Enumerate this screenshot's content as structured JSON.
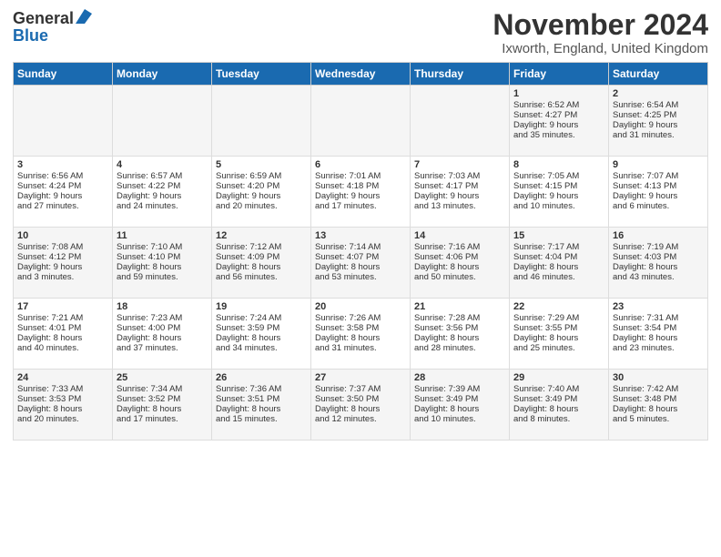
{
  "header": {
    "logo_line1": "General",
    "logo_line2": "Blue",
    "month_title": "November 2024",
    "location": "Ixworth, England, United Kingdom"
  },
  "days_of_week": [
    "Sunday",
    "Monday",
    "Tuesday",
    "Wednesday",
    "Thursday",
    "Friday",
    "Saturday"
  ],
  "weeks": [
    [
      {
        "day": "",
        "info": ""
      },
      {
        "day": "",
        "info": ""
      },
      {
        "day": "",
        "info": ""
      },
      {
        "day": "",
        "info": ""
      },
      {
        "day": "",
        "info": ""
      },
      {
        "day": "1",
        "info": "Sunrise: 6:52 AM\nSunset: 4:27 PM\nDaylight: 9 hours\nand 35 minutes."
      },
      {
        "day": "2",
        "info": "Sunrise: 6:54 AM\nSunset: 4:25 PM\nDaylight: 9 hours\nand 31 minutes."
      }
    ],
    [
      {
        "day": "3",
        "info": "Sunrise: 6:56 AM\nSunset: 4:24 PM\nDaylight: 9 hours\nand 27 minutes."
      },
      {
        "day": "4",
        "info": "Sunrise: 6:57 AM\nSunset: 4:22 PM\nDaylight: 9 hours\nand 24 minutes."
      },
      {
        "day": "5",
        "info": "Sunrise: 6:59 AM\nSunset: 4:20 PM\nDaylight: 9 hours\nand 20 minutes."
      },
      {
        "day": "6",
        "info": "Sunrise: 7:01 AM\nSunset: 4:18 PM\nDaylight: 9 hours\nand 17 minutes."
      },
      {
        "day": "7",
        "info": "Sunrise: 7:03 AM\nSunset: 4:17 PM\nDaylight: 9 hours\nand 13 minutes."
      },
      {
        "day": "8",
        "info": "Sunrise: 7:05 AM\nSunset: 4:15 PM\nDaylight: 9 hours\nand 10 minutes."
      },
      {
        "day": "9",
        "info": "Sunrise: 7:07 AM\nSunset: 4:13 PM\nDaylight: 9 hours\nand 6 minutes."
      }
    ],
    [
      {
        "day": "10",
        "info": "Sunrise: 7:08 AM\nSunset: 4:12 PM\nDaylight: 9 hours\nand 3 minutes."
      },
      {
        "day": "11",
        "info": "Sunrise: 7:10 AM\nSunset: 4:10 PM\nDaylight: 8 hours\nand 59 minutes."
      },
      {
        "day": "12",
        "info": "Sunrise: 7:12 AM\nSunset: 4:09 PM\nDaylight: 8 hours\nand 56 minutes."
      },
      {
        "day": "13",
        "info": "Sunrise: 7:14 AM\nSunset: 4:07 PM\nDaylight: 8 hours\nand 53 minutes."
      },
      {
        "day": "14",
        "info": "Sunrise: 7:16 AM\nSunset: 4:06 PM\nDaylight: 8 hours\nand 50 minutes."
      },
      {
        "day": "15",
        "info": "Sunrise: 7:17 AM\nSunset: 4:04 PM\nDaylight: 8 hours\nand 46 minutes."
      },
      {
        "day": "16",
        "info": "Sunrise: 7:19 AM\nSunset: 4:03 PM\nDaylight: 8 hours\nand 43 minutes."
      }
    ],
    [
      {
        "day": "17",
        "info": "Sunrise: 7:21 AM\nSunset: 4:01 PM\nDaylight: 8 hours\nand 40 minutes."
      },
      {
        "day": "18",
        "info": "Sunrise: 7:23 AM\nSunset: 4:00 PM\nDaylight: 8 hours\nand 37 minutes."
      },
      {
        "day": "19",
        "info": "Sunrise: 7:24 AM\nSunset: 3:59 PM\nDaylight: 8 hours\nand 34 minutes."
      },
      {
        "day": "20",
        "info": "Sunrise: 7:26 AM\nSunset: 3:58 PM\nDaylight: 8 hours\nand 31 minutes."
      },
      {
        "day": "21",
        "info": "Sunrise: 7:28 AM\nSunset: 3:56 PM\nDaylight: 8 hours\nand 28 minutes."
      },
      {
        "day": "22",
        "info": "Sunrise: 7:29 AM\nSunset: 3:55 PM\nDaylight: 8 hours\nand 25 minutes."
      },
      {
        "day": "23",
        "info": "Sunrise: 7:31 AM\nSunset: 3:54 PM\nDaylight: 8 hours\nand 23 minutes."
      }
    ],
    [
      {
        "day": "24",
        "info": "Sunrise: 7:33 AM\nSunset: 3:53 PM\nDaylight: 8 hours\nand 20 minutes."
      },
      {
        "day": "25",
        "info": "Sunrise: 7:34 AM\nSunset: 3:52 PM\nDaylight: 8 hours\nand 17 minutes."
      },
      {
        "day": "26",
        "info": "Sunrise: 7:36 AM\nSunset: 3:51 PM\nDaylight: 8 hours\nand 15 minutes."
      },
      {
        "day": "27",
        "info": "Sunrise: 7:37 AM\nSunset: 3:50 PM\nDaylight: 8 hours\nand 12 minutes."
      },
      {
        "day": "28",
        "info": "Sunrise: 7:39 AM\nSunset: 3:49 PM\nDaylight: 8 hours\nand 10 minutes."
      },
      {
        "day": "29",
        "info": "Sunrise: 7:40 AM\nSunset: 3:49 PM\nDaylight: 8 hours\nand 8 minutes."
      },
      {
        "day": "30",
        "info": "Sunrise: 7:42 AM\nSunset: 3:48 PM\nDaylight: 8 hours\nand 5 minutes."
      }
    ]
  ]
}
